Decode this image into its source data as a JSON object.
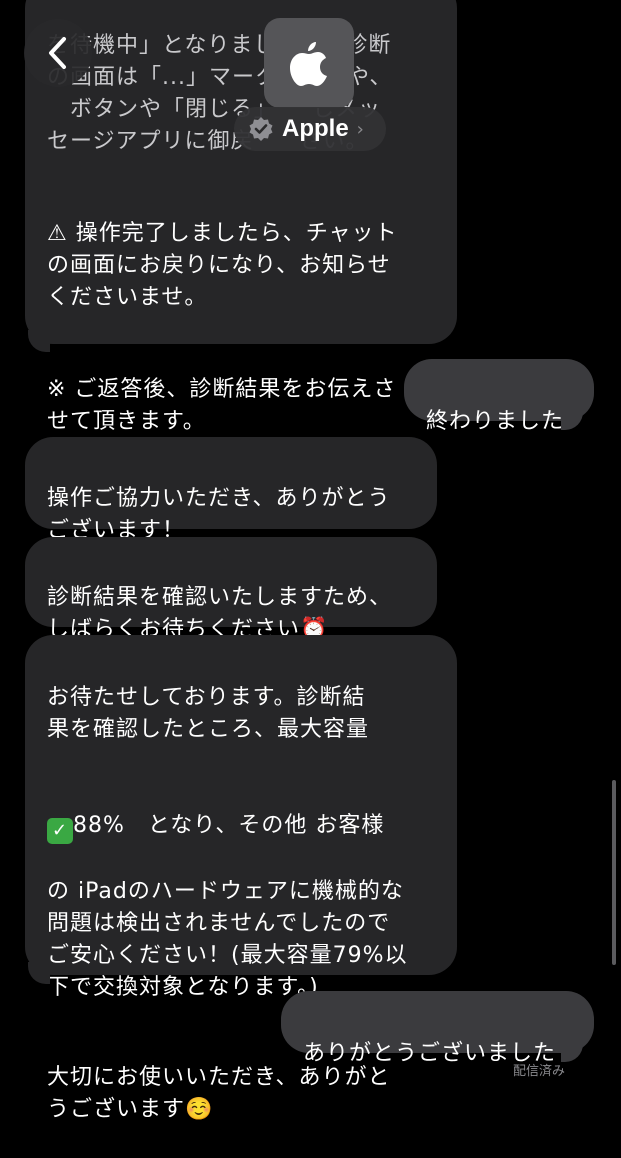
{
  "header": {
    "back_icon": "chevron-left-icon",
    "contact_name": "Apple",
    "avatar_icon": "apple-logo-icon",
    "verified_icon": "verified-badge-icon",
    "chevron": "›"
  },
  "messages": [
    {
      "direction": "incoming",
      "text": "を待機中」となりましたら、診断\nの画面は「...」マーク　　了や、\n　ボタンや「閉じる」　　しメッ\nセージアプリに御戻　　さい。",
      "text2": "⚠ 操作完了しましたら、チャット\nの画面にお戻りになり、お知らせ\nくださいませ。",
      "text3": "※ ご返答後、診断結果をお伝えさ\nせて頂きます。"
    },
    {
      "direction": "outgoing",
      "text": "終わりました"
    },
    {
      "direction": "incoming",
      "text": "操作ご協力いただき、ありがとう\nございます！"
    },
    {
      "direction": "incoming",
      "text": "診断結果を確認いたしますため、\nしばらくお待ちください⏰"
    },
    {
      "direction": "incoming",
      "text_a": "お待たせしております。診断結\n果を確認したところ、最大容量",
      "check": "✓",
      "text_b": "88%　となり、その他 お客様",
      "text_c": "の iPadのハードウェアに機械的な\n問題は検出されませんでしたので\nご安心ください！(最大容量79%以\n下で交換対象となります。)",
      "text_d": "大切にお使いいただき、ありがと\nうございます☺️"
    },
    {
      "direction": "outgoing",
      "text": "ありがとうございました"
    }
  ],
  "status": "配信済み",
  "colors": {
    "background": "#000000",
    "incoming_bubble": "#262628",
    "outgoing_bubble": "#3b3b3e",
    "check_green": "#3aa843"
  }
}
